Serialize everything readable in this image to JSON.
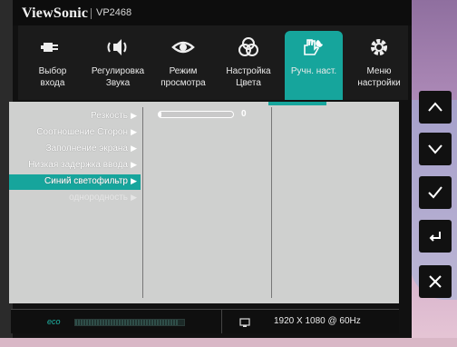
{
  "brand": {
    "name": "ViewSonic",
    "model": "VP2468"
  },
  "top_menu": [
    {
      "label_line1": "Выбор",
      "label_line2": "входа",
      "icon": "input-plug-icon",
      "active": false
    },
    {
      "label_line1": "Регулировка",
      "label_line2": "Звука",
      "icon": "speaker-icon",
      "active": false
    },
    {
      "label_line1": "Режим",
      "label_line2": "просмотра",
      "icon": "eye-icon",
      "active": false
    },
    {
      "label_line1": "Настройка",
      "label_line2": "Цвета",
      "icon": "color-circles-icon",
      "active": false
    },
    {
      "label_line1": "Ручн. наст.",
      "label_line2": "",
      "icon": "hand-wrench-icon",
      "active": true
    },
    {
      "label_line1": "Меню",
      "label_line2": "настройки",
      "icon": "gear-icon",
      "active": false
    }
  ],
  "submenu": [
    {
      "label": "Резкость",
      "arrow": "▶",
      "state": "normal"
    },
    {
      "label": "Соотношение Сторон",
      "arrow": "▶",
      "state": "normal"
    },
    {
      "label": "Заполнение экрана",
      "arrow": "▶",
      "state": "normal"
    },
    {
      "label": "Низкая задержка ввода",
      "arrow": "▶",
      "state": "normal"
    },
    {
      "label": "Синий светофильтр",
      "arrow": "▶",
      "state": "selected"
    },
    {
      "label": "однородность",
      "arrow": "▶",
      "state": "disabled"
    }
  ],
  "slider": {
    "value_text": "0",
    "fraction": 0.0
  },
  "status_bar": {
    "eco_label": "eco",
    "eco_level": 0.95,
    "resolution": "1920 X 1080 @ 60Hz"
  },
  "side_buttons": [
    "up-icon",
    "down-icon",
    "confirm-icon",
    "return-icon",
    "close-icon"
  ],
  "colors": {
    "accent": "#16a59c",
    "panel": "#cfd0cf",
    "osd_bg": "#111111"
  }
}
